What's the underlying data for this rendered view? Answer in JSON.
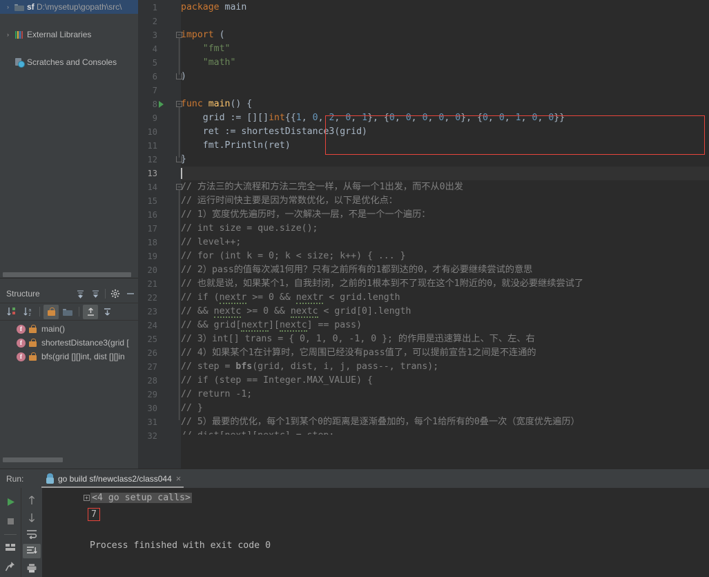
{
  "project_tree": {
    "items": [
      {
        "arrow": "›",
        "icon": "folder-icon",
        "name": "sf",
        "path": "D:\\mysetup\\gopath\\src\\",
        "selected": true
      },
      {
        "arrow": "›",
        "icon": "library-icon",
        "name": "External Libraries",
        "path": "",
        "selected": false
      },
      {
        "arrow": "",
        "icon": "scratches-icon",
        "name": "Scratches and Consoles",
        "path": "",
        "selected": false
      }
    ]
  },
  "structure": {
    "title": "Structure",
    "header_buttons": [
      {
        "name": "expand-all-button",
        "glyph": "≡"
      },
      {
        "name": "collapse-all-button",
        "glyph": "≡"
      },
      {
        "name": "settings-gear-button",
        "glyph": "⚙"
      },
      {
        "name": "hide-panel-button",
        "glyph": "—"
      }
    ],
    "toolbar_buttons": [
      {
        "name": "sort-by-visibility-button",
        "label": "↓",
        "active": false
      },
      {
        "name": "sort-alphabetically-button",
        "label": "↓",
        "active": false
      },
      {
        "name": "show-non-public-button",
        "label": "lock",
        "active": true
      },
      {
        "name": "group-by-file-button",
        "label": "folder",
        "active": false
      },
      {
        "name": "expand-all-structure-button",
        "label": "⤓",
        "active": true
      },
      {
        "name": "collapse-all-structure-button",
        "label": "⤓",
        "active": false
      }
    ],
    "items": [
      {
        "kind": "f",
        "visibility": "private",
        "label": "main()"
      },
      {
        "kind": "f",
        "visibility": "private",
        "label": "shortestDistance3(grid ["
      },
      {
        "kind": "f",
        "visibility": "private",
        "label": "bfs(grid [][]int, dist [][]in"
      }
    ]
  },
  "editor": {
    "lines": [
      {
        "n": 1,
        "segments": [
          {
            "t": "package",
            "c": "kw"
          },
          {
            "t": " main",
            "c": "plain"
          }
        ]
      },
      {
        "n": 2,
        "segments": []
      },
      {
        "n": 3,
        "fold": "minus",
        "segments": [
          {
            "t": "import",
            "c": "kw"
          },
          {
            "t": " (",
            "c": "plain"
          }
        ]
      },
      {
        "n": 4,
        "segments": [
          {
            "t": "    ",
            "c": "plain"
          },
          {
            "t": "\"fmt\"",
            "c": "str"
          }
        ]
      },
      {
        "n": 5,
        "segments": [
          {
            "t": "    ",
            "c": "plain"
          },
          {
            "t": "\"math\"",
            "c": "str"
          }
        ]
      },
      {
        "n": 6,
        "fold": "end",
        "segments": [
          {
            "t": ")",
            "c": "plain"
          }
        ]
      },
      {
        "n": 7,
        "segments": []
      },
      {
        "n": 8,
        "fold": "minus",
        "runnable": true,
        "segments": [
          {
            "t": "func",
            "c": "kw"
          },
          {
            "t": " ",
            "c": "plain"
          },
          {
            "t": "main",
            "c": "fn"
          },
          {
            "t": "() {",
            "c": "plain"
          }
        ]
      },
      {
        "n": 9,
        "segments": [
          {
            "t": "    grid ",
            "c": "plain"
          },
          {
            "t": ":=",
            "c": "plain"
          },
          {
            "t": " [][]",
            "c": "plain"
          },
          {
            "t": "int",
            "c": "kw"
          },
          {
            "t": "{{",
            "c": "plain"
          },
          {
            "t": "1",
            "c": "num"
          },
          {
            "t": ", ",
            "c": "plain"
          },
          {
            "t": "0",
            "c": "num"
          },
          {
            "t": ", ",
            "c": "plain"
          },
          {
            "t": "2",
            "c": "num"
          },
          {
            "t": ", ",
            "c": "plain"
          },
          {
            "t": "0",
            "c": "num"
          },
          {
            "t": ", ",
            "c": "plain"
          },
          {
            "t": "1",
            "c": "num"
          },
          {
            "t": "}, {",
            "c": "plain"
          },
          {
            "t": "0",
            "c": "num"
          },
          {
            "t": ", ",
            "c": "plain"
          },
          {
            "t": "0",
            "c": "num"
          },
          {
            "t": ", ",
            "c": "plain"
          },
          {
            "t": "0",
            "c": "num"
          },
          {
            "t": ", ",
            "c": "plain"
          },
          {
            "t": "0",
            "c": "num"
          },
          {
            "t": ", ",
            "c": "plain"
          },
          {
            "t": "0",
            "c": "num"
          },
          {
            "t": "}, {",
            "c": "plain"
          },
          {
            "t": "0",
            "c": "num"
          },
          {
            "t": ", ",
            "c": "plain"
          },
          {
            "t": "0",
            "c": "num"
          },
          {
            "t": ", ",
            "c": "plain"
          },
          {
            "t": "1",
            "c": "num"
          },
          {
            "t": ", ",
            "c": "plain"
          },
          {
            "t": "0",
            "c": "num"
          },
          {
            "t": ", ",
            "c": "plain"
          },
          {
            "t": "0",
            "c": "num"
          },
          {
            "t": "}}",
            "c": "plain"
          }
        ]
      },
      {
        "n": 10,
        "segments": [
          {
            "t": "    ret ",
            "c": "plain"
          },
          {
            "t": ":=",
            "c": "plain"
          },
          {
            "t": " ",
            "c": "plain"
          },
          {
            "t": "shortestDistance3",
            "c": "plain"
          },
          {
            "t": "(grid)",
            "c": "plain"
          }
        ]
      },
      {
        "n": 11,
        "segments": [
          {
            "t": "    fmt.",
            "c": "plain"
          },
          {
            "t": "Println",
            "c": "plain"
          },
          {
            "t": "(ret)",
            "c": "plain"
          }
        ]
      },
      {
        "n": 12,
        "fold": "end",
        "segments": [
          {
            "t": "}",
            "c": "plain"
          }
        ]
      },
      {
        "n": 13,
        "current": true,
        "caret": true,
        "segments": []
      },
      {
        "n": 14,
        "fold": "minus",
        "segments": [
          {
            "t": "// 方法三的大流程和方法二完全一样，从每一个1出发，而不从0出发",
            "c": "cmt"
          }
        ]
      },
      {
        "n": 15,
        "segments": [
          {
            "t": "// 运行时间快主要是因为常数优化，以下是优化点：",
            "c": "cmt"
          }
        ]
      },
      {
        "n": 16,
        "segments": [
          {
            "t": "// 1）宽度优先遍历时，一次解决一层，不是一个一个遍历：",
            "c": "cmt"
          }
        ]
      },
      {
        "n": 17,
        "segments": [
          {
            "t": "// int size = que.size();",
            "c": "cmt"
          }
        ]
      },
      {
        "n": 18,
        "segments": [
          {
            "t": "// level++;",
            "c": "cmt"
          }
        ]
      },
      {
        "n": 19,
        "segments": [
          {
            "t": "// for (int k = 0; k < size; k++) { ... }",
            "c": "cmt"
          }
        ]
      },
      {
        "n": 20,
        "segments": [
          {
            "t": "// 2）pass的值每次减1何用？只有之前所有的1都到达的0，才有必要继续尝试的意思",
            "c": "cmt"
          }
        ]
      },
      {
        "n": 21,
        "segments": [
          {
            "t": "// 也就是说，如果某个1，自我封闭，之前的1根本到不了现在这个1附近的0，就没必要继续尝试了",
            "c": "cmt"
          }
        ]
      },
      {
        "n": 22,
        "segments": [
          {
            "t": "// if (",
            "c": "cmt"
          },
          {
            "t": "nextr",
            "c": "cmt",
            "typo": true
          },
          {
            "t": " >= 0 && ",
            "c": "cmt"
          },
          {
            "t": "nextr",
            "c": "cmt",
            "typo": true
          },
          {
            "t": " < grid.length",
            "c": "cmt"
          }
        ]
      },
      {
        "n": 23,
        "segments": [
          {
            "t": "// && ",
            "c": "cmt"
          },
          {
            "t": "nextc",
            "c": "cmt",
            "typo": true
          },
          {
            "t": " >= 0 && ",
            "c": "cmt"
          },
          {
            "t": "nextc",
            "c": "cmt",
            "typo": true
          },
          {
            "t": " < grid[0].length",
            "c": "cmt"
          }
        ]
      },
      {
        "n": 24,
        "segments": [
          {
            "t": "// && grid[",
            "c": "cmt"
          },
          {
            "t": "nextr",
            "c": "cmt",
            "typo": true
          },
          {
            "t": "][",
            "c": "cmt"
          },
          {
            "t": "nextc",
            "c": "cmt",
            "typo": true
          },
          {
            "t": "] == pass)",
            "c": "cmt"
          }
        ]
      },
      {
        "n": 25,
        "segments": [
          {
            "t": "// 3）int[] trans = { 0, 1, 0, -1, 0 }; 的作用是迅速算出上、下、左、右",
            "c": "cmt"
          }
        ]
      },
      {
        "n": 26,
        "segments": [
          {
            "t": "// 4）如果某个1在计算时，它周围已经没有pass值了，可以提前宣告1之间是不连通的",
            "c": "cmt"
          }
        ]
      },
      {
        "n": 27,
        "segments": [
          {
            "t": "// step = ",
            "c": "cmt"
          },
          {
            "t": "bfs",
            "c": "cmt-kw"
          },
          {
            "t": "(grid, dist, i, j, pass--, trans);",
            "c": "cmt"
          }
        ]
      },
      {
        "n": 28,
        "segments": [
          {
            "t": "// if (step == Integer.MAX_VALUE) {",
            "c": "cmt"
          }
        ]
      },
      {
        "n": 29,
        "segments": [
          {
            "t": "// return -1;",
            "c": "cmt"
          }
        ]
      },
      {
        "n": 30,
        "segments": [
          {
            "t": "// }",
            "c": "cmt"
          }
        ]
      },
      {
        "n": 31,
        "segments": [
          {
            "t": "// 5）最要的优化，每个1到某个0的距离是逐渐叠加的，每个1给所有的0叠一次（宽度优先遍历）",
            "c": "cmt"
          }
        ]
      },
      {
        "n": 32,
        "clipped": true,
        "segments": [
          {
            "t": "// dist[next][nextc] = step;",
            "c": "cmt"
          }
        ]
      }
    ]
  },
  "run_panel": {
    "run_label": "Run:",
    "tab_title": "go build sf/newclass2/class044",
    "tab_close": "×",
    "console": {
      "setup_line": "<4 go setup calls>",
      "output_value": "7",
      "finish_line": "Process finished with exit code 0"
    },
    "side_buttons": [
      {
        "name": "rerun-button",
        "glyph": "▶"
      },
      {
        "name": "stop-button",
        "glyph": "■"
      },
      {
        "name": "layout-button",
        "glyph": "▤"
      },
      {
        "name": "pin-tab-button",
        "glyph": "◢"
      }
    ],
    "side_buttons2": [
      {
        "name": "scroll-up-button",
        "glyph": "↑"
      },
      {
        "name": "scroll-down-button",
        "glyph": "↓"
      },
      {
        "name": "soft-wrap-button",
        "glyph": "↩"
      },
      {
        "name": "scroll-to-end-button",
        "glyph": "↧"
      },
      {
        "name": "print-button",
        "glyph": "⎙"
      }
    ]
  },
  "colors": {
    "editor_bg": "#2b2b2b",
    "panel_bg": "#3c3f41",
    "gutter_bg": "#313335",
    "selection_blue": "#2f4a6d",
    "highlight_red": "#e8453c",
    "keyword_orange": "#cc7832",
    "string_green": "#6a8759",
    "number_blue": "#6897bb",
    "comment_gray": "#808080",
    "text_gray": "#a9b7c6"
  }
}
